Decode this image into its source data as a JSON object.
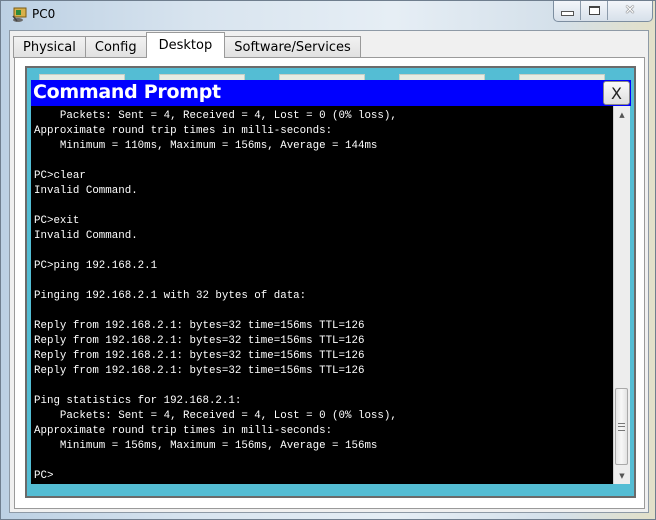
{
  "window": {
    "title": "PC0",
    "app_icon": "packet-tracer-pc-icon",
    "buttons": {
      "minimize": "minimize-icon",
      "maximize": "maximize-icon",
      "close": "close-icon"
    }
  },
  "tabs": [
    {
      "label": "Physical",
      "active": false
    },
    {
      "label": "Config",
      "active": false
    },
    {
      "label": "Desktop",
      "active": true
    },
    {
      "label": "Software/Services",
      "active": false
    }
  ],
  "command_prompt": {
    "title": "Command Prompt",
    "close_label": "X",
    "colors": {
      "header": "#0000ff",
      "background": "#000000",
      "text": "#ffffff",
      "desktop": "#54bdd4"
    },
    "lines": [
      "    Packets: Sent = 4, Received = 4, Lost = 0 (0% loss),",
      "Approximate round trip times in milli-seconds:",
      "    Minimum = 110ms, Maximum = 156ms, Average = 144ms",
      "",
      "PC>clear",
      "Invalid Command.",
      "",
      "PC>exit",
      "Invalid Command.",
      "",
      "PC>ping 192.168.2.1",
      "",
      "Pinging 192.168.2.1 with 32 bytes of data:",
      "",
      "Reply from 192.168.2.1: bytes=32 time=156ms TTL=126",
      "Reply from 192.168.2.1: bytes=32 time=156ms TTL=126",
      "Reply from 192.168.2.1: bytes=32 time=156ms TTL=126",
      "Reply from 192.168.2.1: bytes=32 time=156ms TTL=126",
      "",
      "Ping statistics for 192.168.2.1:",
      "    Packets: Sent = 4, Received = 4, Lost = 0 (0% loss),",
      "Approximate round trip times in milli-seconds:",
      "    Minimum = 156ms, Maximum = 156ms, Average = 156ms",
      "",
      "PC>"
    ],
    "scroll_position": "bottom"
  }
}
